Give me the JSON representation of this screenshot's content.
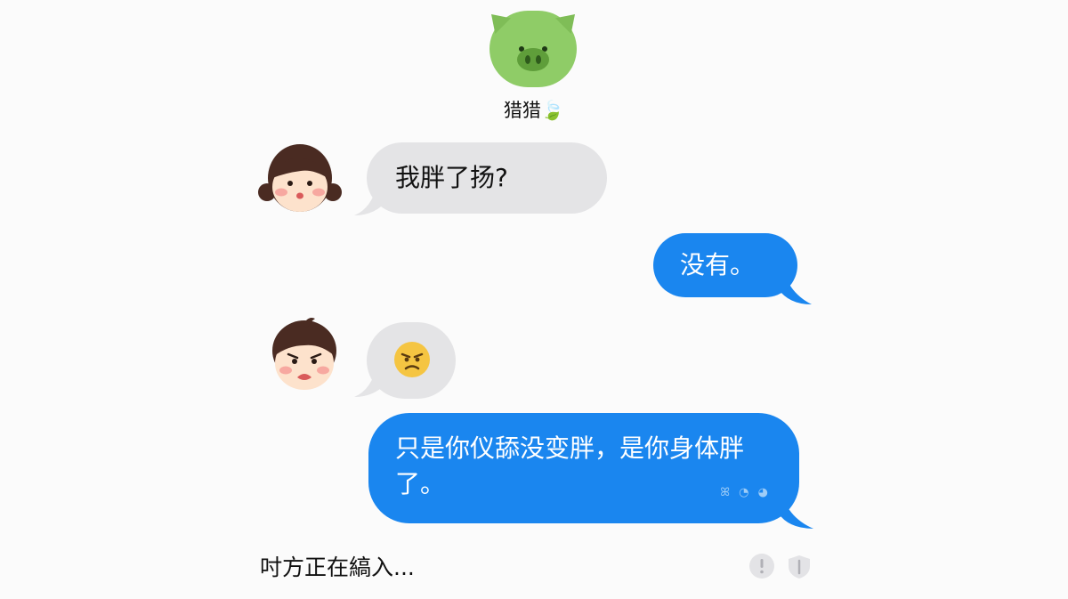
{
  "contact": {
    "name": "猎猎",
    "name_suffix": "🍃"
  },
  "messages": [
    {
      "from": "her",
      "text": "我胖了扬?"
    },
    {
      "from": "me",
      "text": "没有。"
    },
    {
      "from": "her",
      "text": "",
      "emoji": "angry-face"
    },
    {
      "from": "me",
      "text": "只是你仪舔没变胖，是你身体胖了。",
      "meta": "ꕤ ◔ ◕"
    }
  ],
  "status": {
    "typing": "吋方正在縞入..."
  },
  "colors": {
    "incoming_bubble": "#e4e4e6",
    "outgoing_bubble": "#1a86ef",
    "pig_green": "#8fcc67"
  }
}
